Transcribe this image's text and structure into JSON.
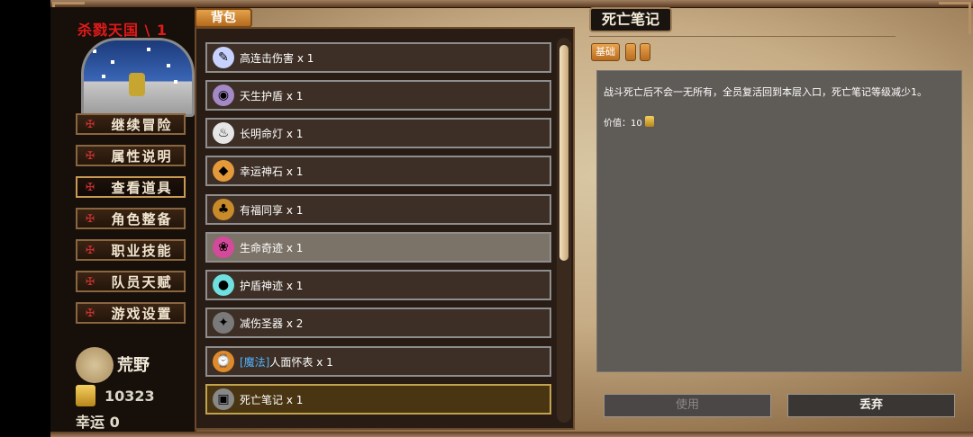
{
  "left_panel": {
    "level_title": "杀戮天国 \\ 1",
    "menu": [
      {
        "label": "继续冒险",
        "icon": "menu-emblem-icon"
      },
      {
        "label": "属性说明",
        "icon": "menu-emblem-icon"
      },
      {
        "label": "查看道具",
        "icon": "menu-emblem-icon"
      },
      {
        "label": "角色整备",
        "icon": "menu-emblem-icon"
      },
      {
        "label": "职业技能",
        "icon": "menu-emblem-icon"
      },
      {
        "label": "队员天赋",
        "icon": "menu-emblem-icon"
      },
      {
        "label": "游戏设置",
        "icon": "menu-emblem-icon"
      }
    ],
    "active_menu": "查看道具",
    "area_name": "荒野",
    "gold": "10323",
    "luck": "幸运 0"
  },
  "inventory": {
    "tab_label": "背包",
    "items": [
      {
        "prefix": "",
        "name": "高连击伤害 x 1",
        "icon": "scroll-icon",
        "color": "#c7d2ff"
      },
      {
        "prefix": "",
        "name": "天生护盾 x 1",
        "icon": "orb-icon",
        "color": "#a38ac7"
      },
      {
        "prefix": "",
        "name": "长明命灯 x 1",
        "icon": "lamp-icon",
        "color": "#e6e6e6"
      },
      {
        "prefix": "",
        "name": "幸运神石 x 1",
        "icon": "stone-icon",
        "color": "#e49a3a"
      },
      {
        "prefix": "",
        "name": "有福同享 x 1",
        "icon": "pot-icon",
        "color": "#c98a2a"
      },
      {
        "prefix": "",
        "name": "生命奇迹 x 1",
        "icon": "heart-orb-icon",
        "color": "#d44a9a"
      },
      {
        "prefix": "",
        "name": "护盾神迹 x 1",
        "icon": "shield-orb-icon",
        "color": "#6fe0e0"
      },
      {
        "prefix": "",
        "name": "减伤圣器 x 2",
        "icon": "relic-icon",
        "color": "#7a7a7a"
      },
      {
        "prefix": "[魔法]",
        "name": " 人面怀表  x 1",
        "icon": "pocket-watch-icon",
        "color": "#e08a2a"
      },
      {
        "prefix": "",
        "name": "死亡笔记 x 1",
        "icon": "death-note-icon",
        "color": "#888888"
      }
    ],
    "highlighted_index": 5,
    "selected_index": 9
  },
  "detail": {
    "title": "死亡笔记",
    "tabs": [
      "基础",
      "",
      ""
    ],
    "description": "战斗死亡后不会一无所有，全员复活回到本层入口，死亡笔记等级减少1。",
    "price_label": "价值：10",
    "use_label": "使用",
    "drop_label": "丢弃"
  },
  "colors": {
    "accent_orange": "#e3a24a",
    "level_title_red": "#e11a1a",
    "magic_blue": "#4fb3ff"
  }
}
